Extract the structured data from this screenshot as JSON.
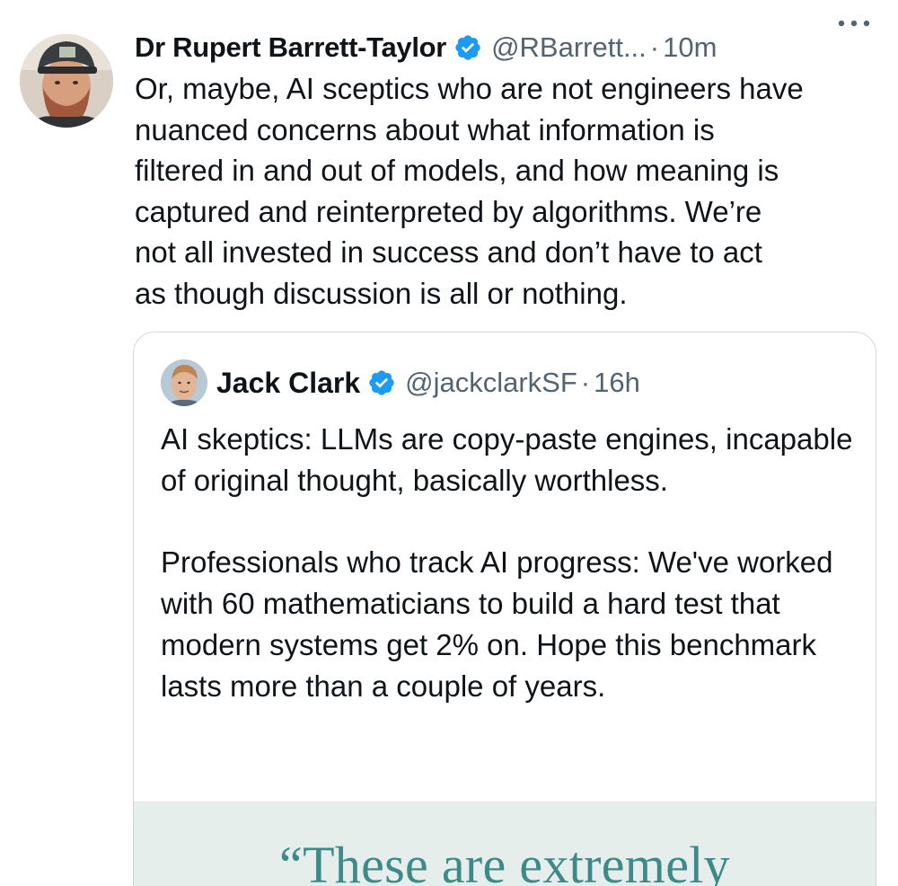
{
  "tweet": {
    "author_name": "Dr Rupert Barrett-Taylor",
    "handle": "@RBarrett...",
    "separator": "·",
    "time": "10m",
    "body": "Or, maybe, AI sceptics who are not engineers have\nnuanced concerns about what information is\nfiltered in and out of models, and how meaning is\ncaptured and reinterpreted by algorithms. We’re\nnot all invested in success and don’t have to act\nas though discussion is all or nothing."
  },
  "quoted_tweet": {
    "author_name": "Jack Clark",
    "handle": "@jackclarkSF",
    "separator": "·",
    "time": "16h",
    "paragraph_1": "AI skeptics: LLMs are copy-paste engines, incapable of original thought, basically worthless.",
    "paragraph_2": "Professionals who track AI progress: We've worked with 60 mathematicians to build a hard test that modern systems get 2% on. Hope this benchmark lasts more than a couple of years.",
    "media_caption": "“These are extremely"
  },
  "icons": {
    "verified": "verified-badge-icon",
    "more": "more-horizontal-icon"
  },
  "colors": {
    "text_primary": "#0f1419",
    "text_secondary": "#536471",
    "verified_blue": "#1d9bf0",
    "border": "#cfd9de",
    "media_bg": "#e6eeec",
    "media_text": "#3d8a8a"
  }
}
